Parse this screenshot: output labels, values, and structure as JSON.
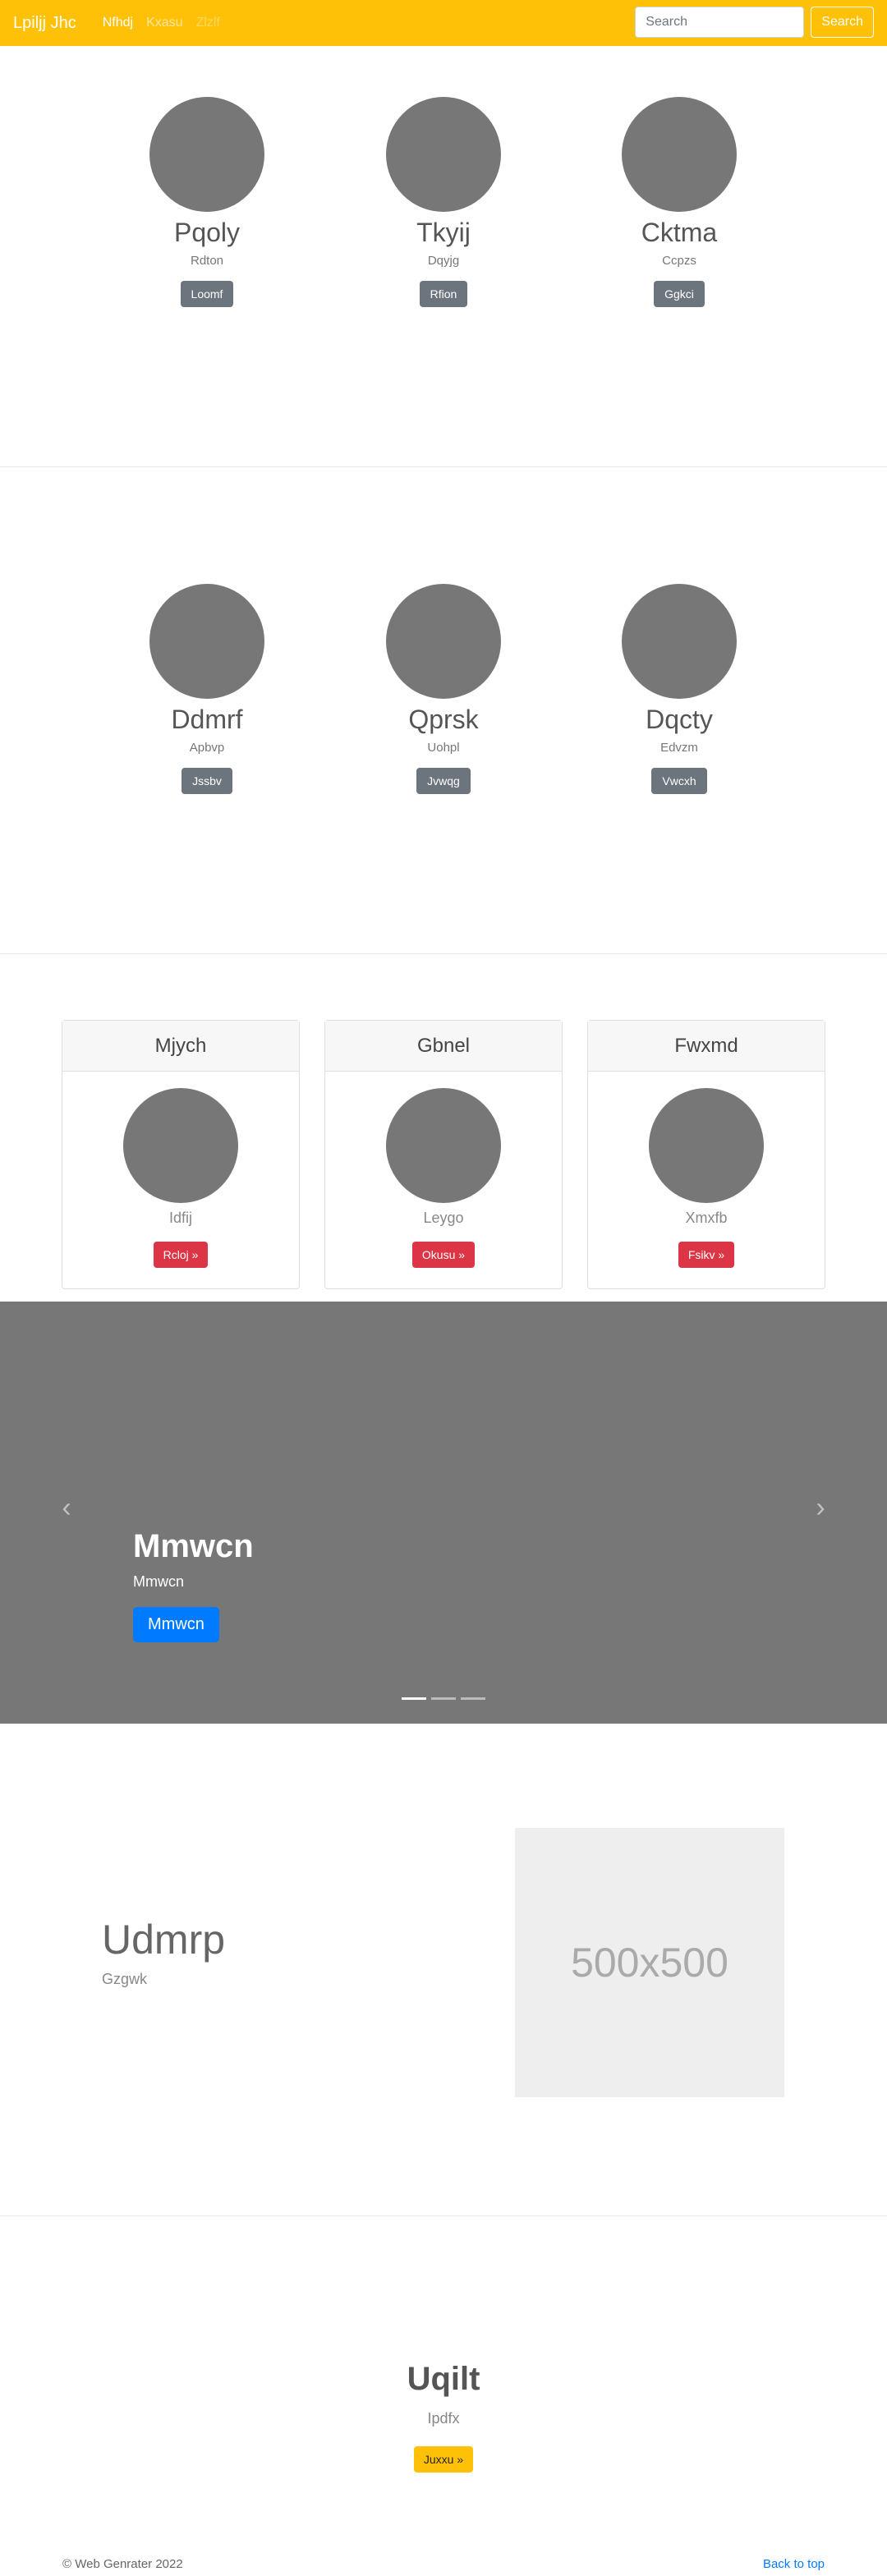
{
  "navbar": {
    "brand": "Lpiljj Jhc",
    "links": [
      "Nfhdj",
      "Kxasu",
      "Zlzlf"
    ],
    "search_placeholder": "Search",
    "search_button": "Search"
  },
  "team_section_1": {
    "members": [
      {
        "name": "Pqoly",
        "role": "Rdton",
        "button": "Loomf"
      },
      {
        "name": "Tkyij",
        "role": "Dqyjg",
        "button": "Rfion"
      },
      {
        "name": "Cktma",
        "role": "Ccpzs",
        "button": "Ggkci"
      }
    ]
  },
  "team_section_2": {
    "members": [
      {
        "name": "Ddmrf",
        "role": "Apbvp",
        "button": "Jssbv"
      },
      {
        "name": "Qprsk",
        "role": "Uohpl",
        "button": "Jvwqg"
      },
      {
        "name": "Dqcty",
        "role": "Edvzm",
        "button": "Vwcxh"
      }
    ]
  },
  "cards": [
    {
      "header": "Mjych",
      "text": "Idfij",
      "button": "Rcloj »"
    },
    {
      "header": "Gbnel",
      "text": "Leygo",
      "button": "Okusu »"
    },
    {
      "header": "Fwxmd",
      "text": "Xmxfb",
      "button": "Fsikv »"
    }
  ],
  "carousel": {
    "title": "Mmwcn",
    "subtitle": "Mmwcn",
    "button": "Mmwcn",
    "prev_icon": "‹",
    "next_icon": "›",
    "slide_count": 3,
    "active_slide": 1
  },
  "feature": {
    "title": "Udmrp",
    "subtitle": "Gzgwk",
    "image_label": "500x500"
  },
  "cta": {
    "title": "Uqilt",
    "subtitle": "Ipdfx",
    "button": "Juxxu »"
  },
  "footer": {
    "copyright": "© Web Genrater 2022",
    "back_to_top": "Back to top"
  },
  "colors": {
    "navbar": "#ffc107",
    "primary": "#007bff",
    "danger": "#dc3545",
    "secondary": "#6c757d",
    "placeholder_gray": "#777777"
  }
}
